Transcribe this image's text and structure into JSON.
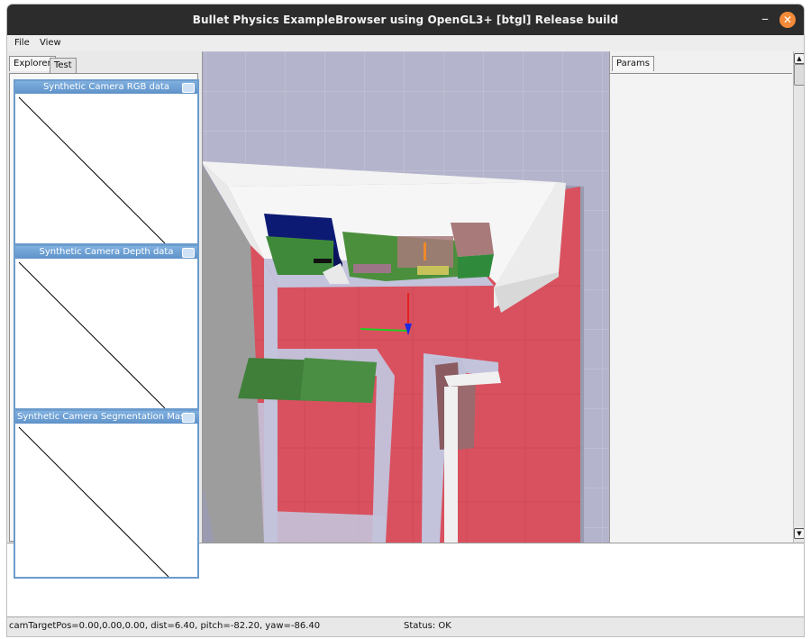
{
  "window": {
    "title": "Bullet Physics ExampleBrowser using OpenGL3+ [btgl] Release build",
    "minimize_glyph": "–",
    "close_glyph": "✕"
  },
  "menu": {
    "items": [
      "File",
      "View"
    ]
  },
  "explorer": {
    "tabs": [
      "Explorer",
      "Test"
    ],
    "windows": [
      {
        "title": "Synthetic Camera RGB data"
      },
      {
        "title": "Synthetic Camera Depth data"
      },
      {
        "title": "Synthetic Camera Segmentation Mask"
      }
    ]
  },
  "params": {
    "tab": "Params"
  },
  "scrollbar": {
    "up_glyph": "▲",
    "down_glyph": "▼"
  },
  "status": {
    "camera": "camTargetPos=0.00,0.00,0.00, dist=6.40, pitch=-82.20, yaw=-86.40",
    "state": "Status: OK"
  },
  "colors": {
    "titlebar": "#2c2c2c",
    "close_button": "#f38a3a",
    "floor": "#d9515f",
    "wall": "#f3f3f3",
    "camera_window_border": "#6c9ccd"
  }
}
